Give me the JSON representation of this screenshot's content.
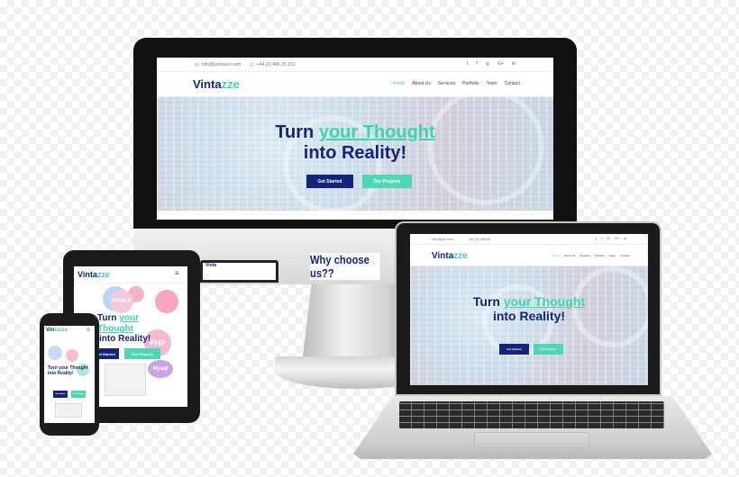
{
  "desktop": {
    "topbar": {
      "email": "info@pamarex.com",
      "phone": "+44 (0) 486 25 153",
      "social_icons": [
        "twitter-icon",
        "facebook-icon",
        "instagram-icon",
        "google-plus-icon",
        "linkedin-icon"
      ],
      "social_glyphs": [
        "t",
        "f",
        "◎",
        "G+",
        "in"
      ]
    },
    "logo": {
      "part1": "Vinta",
      "part2": "zze"
    },
    "nav": [
      "Home",
      "About Us",
      "Services",
      "Portfolio",
      "Team",
      "Contact"
    ],
    "hero": {
      "line1_start": "Turn ",
      "line1_accent": "your Thought",
      "line2": "into Reality!",
      "primary_button": "Get Started",
      "secondary_button": "Our Projects"
    },
    "why_heading": "Why choose us??"
  },
  "laptop": {
    "topbar": {
      "email": "info@ytz.com",
      "phone": "+44 (0) 48625"
    },
    "logo": {
      "part1": "Vinta",
      "part2": "zze"
    },
    "nav": [
      "Home",
      "About Us",
      "Services",
      "Portfolio",
      "Team",
      "Contact"
    ],
    "hero": {
      "line1_start": "Turn ",
      "line1_accent": "your Thought",
      "line2": "into Reality!",
      "primary_button": "Get Started",
      "secondary_button": "Our Projects"
    }
  },
  "tablet": {
    "logo": {
      "part1": "Vinta",
      "part2": "zze"
    },
    "hero": {
      "line1_start": "Turn ",
      "line1_accent": "your Thought",
      "line2": "into Reality!",
      "primary_button": "Get Started",
      "secondary_button": "Our Projects"
    },
    "bubbles": [
      "HTML5",
      "PHP",
      "Mysql"
    ]
  },
  "phone": {
    "logo": {
      "part1": "Vin",
      "part2": "tazze"
    },
    "hero": {
      "line1": "Turn your Thought",
      "line2": "into Reality!"
    },
    "primary_button": "Get Started",
    "secondary_button": "Our Projects"
  },
  "colors": {
    "brand_navy": "#13247a",
    "brand_teal": "#3fd3ad",
    "button_teal": "#4fd6b2"
  }
}
